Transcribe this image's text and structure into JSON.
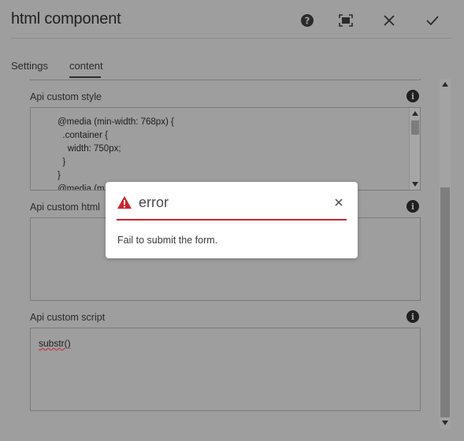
{
  "window": {
    "title": "html component"
  },
  "toolbar": {
    "help_icon": "help-icon",
    "fullscreen_icon": "fullscreen-icon",
    "close_icon": "close-icon",
    "done_icon": "checkmark-icon"
  },
  "tabs": [
    {
      "label": "Settings",
      "active": false
    },
    {
      "label": "content",
      "active": true
    }
  ],
  "fields": {
    "style": {
      "label": "Api custom style",
      "lines": [
        "@media (min-width: 768px) {",
        "  .container {",
        "    width: 750px;",
        "  }",
        "}",
        "@media (m"
      ]
    },
    "html": {
      "label": "Api custom html",
      "value": ""
    },
    "script": {
      "label": "Api custom script",
      "value": "substr()"
    }
  },
  "modal": {
    "title": "error",
    "message": "Fail to submit the form.",
    "accent_color": "#c9252c",
    "alert_icon": "alert-triangle-icon",
    "close_icon": "close-icon"
  }
}
